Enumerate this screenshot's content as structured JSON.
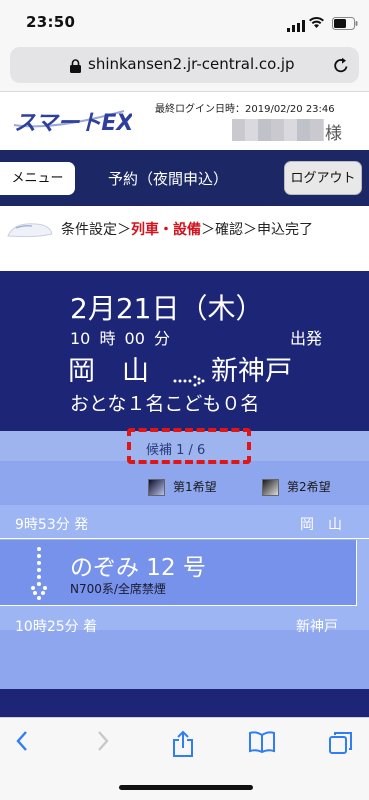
{
  "status": {
    "time": "23:50"
  },
  "browser": {
    "url": "shinkansen2.jr-central.co.jp"
  },
  "header": {
    "logo_text": "スマートEX",
    "last_login": "最終ログイン日時：2019/02/20 23:46",
    "honorific": "様"
  },
  "nav": {
    "menu": "メニュー",
    "title": "予約（夜間申込）",
    "logout": "ログアウト"
  },
  "steps": {
    "s1": "条件設定＞",
    "s2": "列車・設備",
    "s3": "＞確認＞申込完了"
  },
  "summary": {
    "date": "2月21日（木）",
    "time": "10 時 00 分",
    "dep_label": "出発",
    "from": "岡　山",
    "to": "新神戸",
    "passengers": "おとな１名こども０名"
  },
  "candidates": {
    "pager": "候補 1 / 6",
    "legend_first": "第1希望",
    "legend_second": "第2希望"
  },
  "train": {
    "dep_time": "9時53分 発",
    "dep_station": "岡　山",
    "name": "のぞみ 12 号",
    "sub": "N700系/全席禁煙",
    "arr_time": "10時25分 着",
    "arr_station": "新神戸"
  }
}
